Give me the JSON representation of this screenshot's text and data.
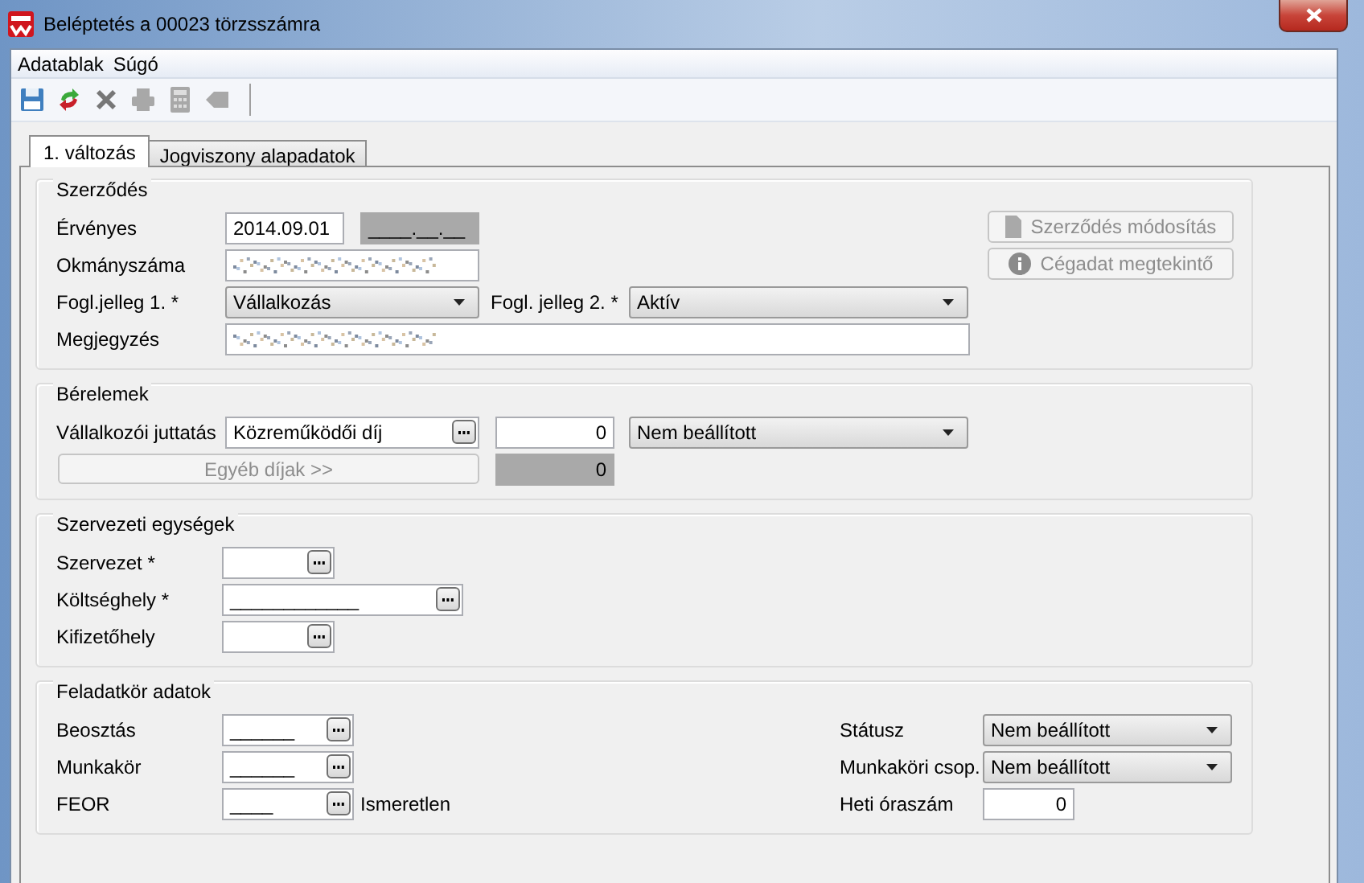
{
  "window": {
    "title": "Beléptetés a 00023 törzsszámra"
  },
  "menu": [
    "Adatablak",
    "Súgó"
  ],
  "toolbar": [
    {
      "kind": "save",
      "disabled": false
    },
    {
      "kind": "refresh",
      "disabled": false
    },
    {
      "kind": "delete",
      "disabled": false
    },
    {
      "kind": "print",
      "disabled": true
    },
    {
      "kind": "calculator",
      "disabled": true
    },
    {
      "kind": "tag",
      "disabled": true
    }
  ],
  "tabs": [
    {
      "label": "1. változás",
      "selected": true
    },
    {
      "label": "Jogviszony alapadatok",
      "selected": false
    }
  ],
  "contract": {
    "title": "Szerződés",
    "valid_label": "Érvényes",
    "valid_from": "2014.09.01",
    "valid_to": "____.__.__",
    "document_label": "Okmányszáma",
    "document_redacted": true,
    "type1_label": "Fogl.jelleg 1. *",
    "type1": "Vállalkozás",
    "type2_label": "Fogl. jelleg 2. *",
    "type2": "Aktív",
    "note_label": "Megjegyzés",
    "note_redacted": true,
    "buttons": [
      {
        "kind": "document",
        "label": "Szerződés módosítás",
        "disabled": true
      },
      {
        "kind": "info",
        "label": "Cégadat megtekintő",
        "disabled": true
      }
    ]
  },
  "wages": {
    "title": "Bérelemek",
    "label": "Vállalkozói juttatás",
    "item": "Közreműködői díj",
    "amount": "0",
    "option": "Nem beállított",
    "other_button": {
      "label": "Egyéb díjak >>",
      "disabled": true
    },
    "other_amount": "0"
  },
  "units": {
    "title": "Szervezeti egységek",
    "fields": [
      {
        "label": "Szervezet *"
      },
      {
        "label": "Költséghely *",
        "value": "____________"
      },
      {
        "label": "Kifizetőhely"
      }
    ]
  },
  "duties": {
    "title": "Feladatkör adatok",
    "fields": [
      {
        "label": "Beosztás",
        "value": "______"
      },
      {
        "label": "Munkakör",
        "value": "______"
      },
      {
        "label": "FEOR",
        "value": "____",
        "note": "Ismeretlen"
      }
    ],
    "status_label": "Státusz",
    "status": "Nem beállított",
    "group_label": "Munkaköri csop.",
    "group": "Nem beállított",
    "hours_label": "Heti óraszám",
    "hours": "0"
  }
}
